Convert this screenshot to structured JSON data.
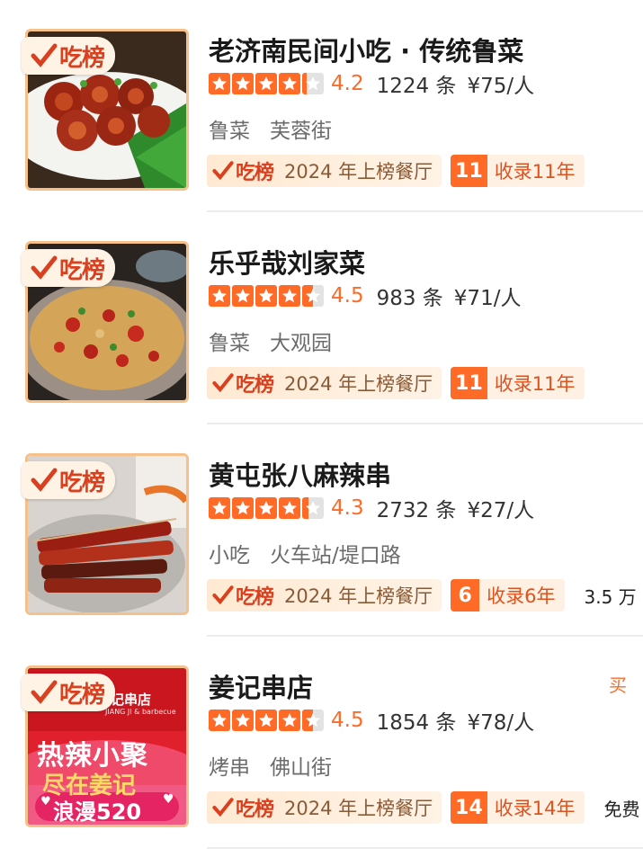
{
  "badge_label": "吃榜",
  "award_brand": "吃榜",
  "restaurants": [
    {
      "name": "老济南民间小吃 · 传统鲁菜",
      "rating": 4.2,
      "score": "4.2",
      "reviews": "1224 条",
      "price": "¥75/人",
      "tags": [
        "鲁菜",
        "芙蓉街"
      ],
      "award_year": "2024 年上榜餐厅",
      "years_num": "11",
      "years_text": "收录11年",
      "extra": "",
      "corner": "",
      "photo": "braised-pork-dish"
    },
    {
      "name": "乐乎哉刘家菜",
      "rating": 4.5,
      "score": "4.5",
      "reviews": "983 条",
      "price": "¥71/人",
      "tags": [
        "鲁菜",
        "大观园"
      ],
      "award_year": "2024 年上榜餐厅",
      "years_num": "11",
      "years_text": "收录11年",
      "extra": "",
      "corner": "",
      "photo": "spicy-stir-fry-dish"
    },
    {
      "name": "黄屯张八麻辣串",
      "rating": 4.3,
      "score": "4.3",
      "reviews": "2732 条",
      "price": "¥27/人",
      "tags": [
        "小吃",
        "火车站/堤口路"
      ],
      "award_year": "2024 年上榜餐厅",
      "years_num": "6",
      "years_text": "收录6年",
      "extra": "3.5 万",
      "corner": "",
      "photo": "skewers-dish"
    },
    {
      "name": "姜记串店",
      "rating": 4.5,
      "score": "4.5",
      "reviews": "1854 条",
      "price": "¥78/人",
      "tags": [
        "烤串",
        "佛山街"
      ],
      "award_year": "2024 年上榜餐厅",
      "years_num": "14",
      "years_text": "收录14年",
      "extra": "免费",
      "corner": "买",
      "photo": "promo-poster",
      "poster": {
        "store": "记串店",
        "store_en": "JIANG JI & barbecue",
        "line1": "热辣小聚",
        "line2": "尽在姜记",
        "line3": "浪漫520"
      }
    }
  ],
  "colors": {
    "accent": "#ff6a26",
    "brand_red": "#d8401f",
    "star_empty": "#e3e3e3",
    "tag_gray": "#6b6b6b"
  }
}
